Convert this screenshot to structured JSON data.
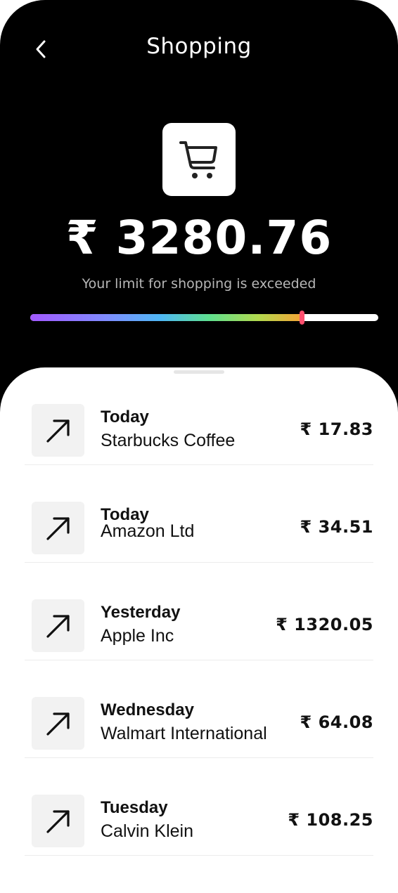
{
  "header": {
    "title": "Shopping",
    "back_icon": "chevron-left-icon"
  },
  "summary": {
    "category_icon": "shopping-cart-icon",
    "amount": "₹ 3280.76",
    "limit_message": "Your limit for shopping is exceeded",
    "progress_fraction": 0.78,
    "colors": {
      "knob": "#ff4f6e",
      "gradient": [
        "#a259ff",
        "#4fb8f5",
        "#5fe08f",
        "#f5a436"
      ]
    }
  },
  "transactions": [
    {
      "day": "Today",
      "merchant": "Starbucks Coffee",
      "amount": "₹ 17.83",
      "icon": "arrow-up-right-icon"
    },
    {
      "day": "Today",
      "merchant": "Amazon Ltd",
      "amount": "₹ 34.51",
      "icon": "arrow-up-right-icon"
    },
    {
      "day": "Yesterday",
      "merchant": "Apple Inc",
      "amount": "₹ 1320.05",
      "icon": "arrow-up-right-icon"
    },
    {
      "day": "Wednesday",
      "merchant": "Walmart International",
      "amount": "₹ 64.08",
      "icon": "arrow-up-right-icon"
    },
    {
      "day": "Tuesday",
      "merchant": "Calvin Klein",
      "amount": "₹ 108.25",
      "icon": "arrow-up-right-icon"
    }
  ]
}
